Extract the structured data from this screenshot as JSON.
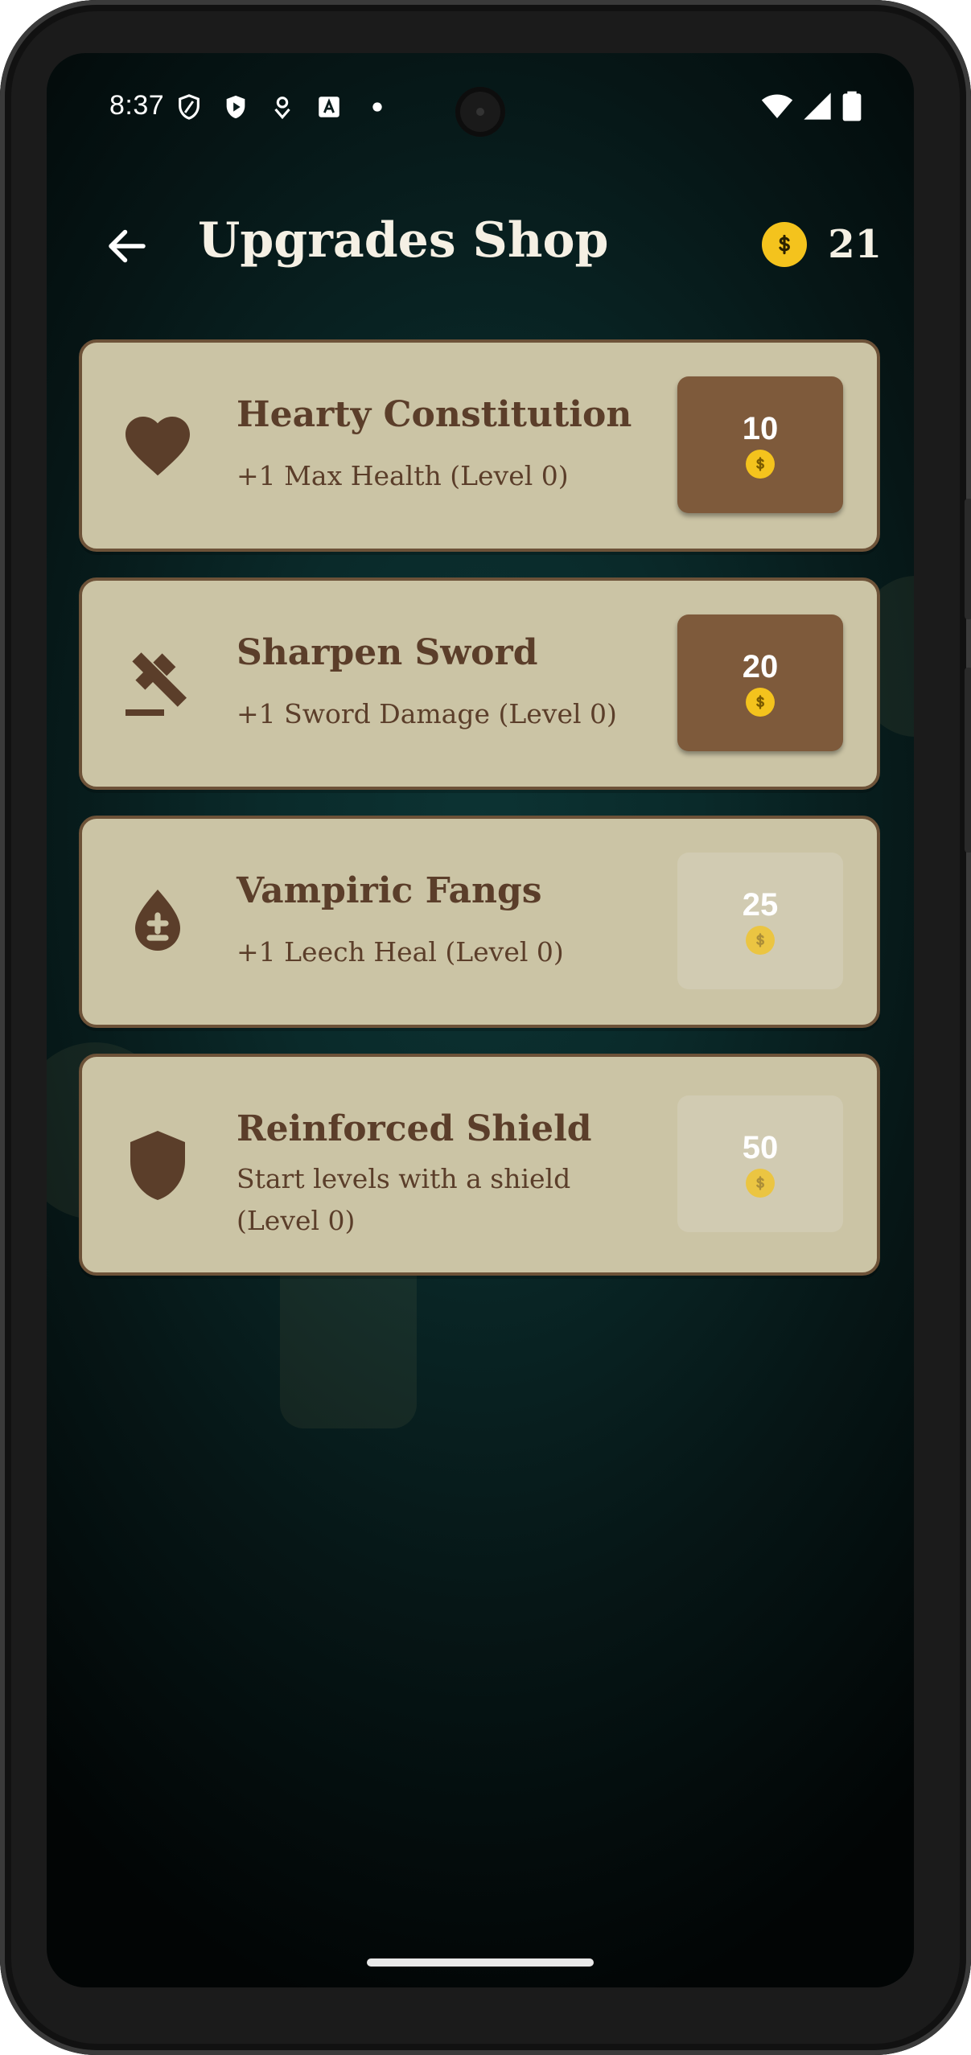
{
  "status_bar": {
    "time": "8:37",
    "left_icons": [
      "vpn-shield-icon",
      "play-protect-icon",
      "location-pin-icon",
      "text-a-icon",
      "dot-icon"
    ],
    "right_icons": [
      "wifi-icon",
      "cell-signal-icon",
      "battery-icon"
    ]
  },
  "header": {
    "title": "Upgrades Shop",
    "back_icon": "back-arrow-icon",
    "coin_icon": "coin-icon",
    "coins": "21"
  },
  "upgrades": [
    {
      "icon": "heart-icon",
      "name": "Hearty Constitution",
      "description": "+1 Max Health (Level 0)",
      "price": "10",
      "enabled": true
    },
    {
      "icon": "sword-sharpen-icon",
      "name": "Sharpen Sword",
      "description": "+1 Sword Damage (Level 0)",
      "price": "20",
      "enabled": true
    },
    {
      "icon": "blood-drop-icon",
      "name": "Vampiric Fangs",
      "description": "+1 Leech Heal (Level 0)",
      "price": "25",
      "enabled": false
    },
    {
      "icon": "shield-icon",
      "name": "Reinforced Shield",
      "description": "Start levels with a shield (Level 0)",
      "price": "50",
      "enabled": false
    }
  ],
  "colors": {
    "card_bg": "#cbc4a5",
    "card_border": "#6d5238",
    "text_brown": "#5b3e2a",
    "button_brown": "#7e5a3b",
    "coin_gold": "#f4c31d"
  }
}
